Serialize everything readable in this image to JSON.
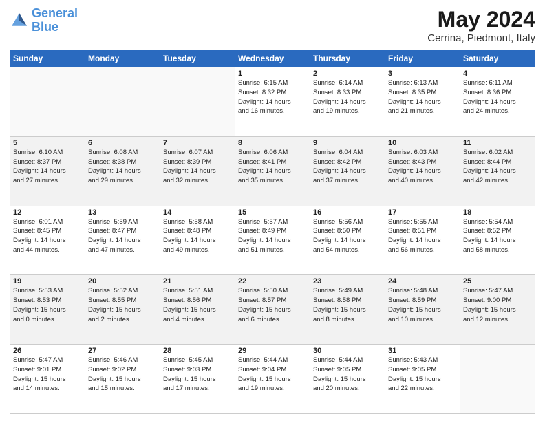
{
  "header": {
    "logo_line1": "General",
    "logo_line2": "Blue",
    "month": "May 2024",
    "location": "Cerrina, Piedmont, Italy"
  },
  "weekdays": [
    "Sunday",
    "Monday",
    "Tuesday",
    "Wednesday",
    "Thursday",
    "Friday",
    "Saturday"
  ],
  "weeks": [
    [
      {
        "day": "",
        "info": ""
      },
      {
        "day": "",
        "info": ""
      },
      {
        "day": "",
        "info": ""
      },
      {
        "day": "1",
        "info": "Sunrise: 6:15 AM\nSunset: 8:32 PM\nDaylight: 14 hours\nand 16 minutes."
      },
      {
        "day": "2",
        "info": "Sunrise: 6:14 AM\nSunset: 8:33 PM\nDaylight: 14 hours\nand 19 minutes."
      },
      {
        "day": "3",
        "info": "Sunrise: 6:13 AM\nSunset: 8:35 PM\nDaylight: 14 hours\nand 21 minutes."
      },
      {
        "day": "4",
        "info": "Sunrise: 6:11 AM\nSunset: 8:36 PM\nDaylight: 14 hours\nand 24 minutes."
      }
    ],
    [
      {
        "day": "5",
        "info": "Sunrise: 6:10 AM\nSunset: 8:37 PM\nDaylight: 14 hours\nand 27 minutes."
      },
      {
        "day": "6",
        "info": "Sunrise: 6:08 AM\nSunset: 8:38 PM\nDaylight: 14 hours\nand 29 minutes."
      },
      {
        "day": "7",
        "info": "Sunrise: 6:07 AM\nSunset: 8:39 PM\nDaylight: 14 hours\nand 32 minutes."
      },
      {
        "day": "8",
        "info": "Sunrise: 6:06 AM\nSunset: 8:41 PM\nDaylight: 14 hours\nand 35 minutes."
      },
      {
        "day": "9",
        "info": "Sunrise: 6:04 AM\nSunset: 8:42 PM\nDaylight: 14 hours\nand 37 minutes."
      },
      {
        "day": "10",
        "info": "Sunrise: 6:03 AM\nSunset: 8:43 PM\nDaylight: 14 hours\nand 40 minutes."
      },
      {
        "day": "11",
        "info": "Sunrise: 6:02 AM\nSunset: 8:44 PM\nDaylight: 14 hours\nand 42 minutes."
      }
    ],
    [
      {
        "day": "12",
        "info": "Sunrise: 6:01 AM\nSunset: 8:45 PM\nDaylight: 14 hours\nand 44 minutes."
      },
      {
        "day": "13",
        "info": "Sunrise: 5:59 AM\nSunset: 8:47 PM\nDaylight: 14 hours\nand 47 minutes."
      },
      {
        "day": "14",
        "info": "Sunrise: 5:58 AM\nSunset: 8:48 PM\nDaylight: 14 hours\nand 49 minutes."
      },
      {
        "day": "15",
        "info": "Sunrise: 5:57 AM\nSunset: 8:49 PM\nDaylight: 14 hours\nand 51 minutes."
      },
      {
        "day": "16",
        "info": "Sunrise: 5:56 AM\nSunset: 8:50 PM\nDaylight: 14 hours\nand 54 minutes."
      },
      {
        "day": "17",
        "info": "Sunrise: 5:55 AM\nSunset: 8:51 PM\nDaylight: 14 hours\nand 56 minutes."
      },
      {
        "day": "18",
        "info": "Sunrise: 5:54 AM\nSunset: 8:52 PM\nDaylight: 14 hours\nand 58 minutes."
      }
    ],
    [
      {
        "day": "19",
        "info": "Sunrise: 5:53 AM\nSunset: 8:53 PM\nDaylight: 15 hours\nand 0 minutes."
      },
      {
        "day": "20",
        "info": "Sunrise: 5:52 AM\nSunset: 8:55 PM\nDaylight: 15 hours\nand 2 minutes."
      },
      {
        "day": "21",
        "info": "Sunrise: 5:51 AM\nSunset: 8:56 PM\nDaylight: 15 hours\nand 4 minutes."
      },
      {
        "day": "22",
        "info": "Sunrise: 5:50 AM\nSunset: 8:57 PM\nDaylight: 15 hours\nand 6 minutes."
      },
      {
        "day": "23",
        "info": "Sunrise: 5:49 AM\nSunset: 8:58 PM\nDaylight: 15 hours\nand 8 minutes."
      },
      {
        "day": "24",
        "info": "Sunrise: 5:48 AM\nSunset: 8:59 PM\nDaylight: 15 hours\nand 10 minutes."
      },
      {
        "day": "25",
        "info": "Sunrise: 5:47 AM\nSunset: 9:00 PM\nDaylight: 15 hours\nand 12 minutes."
      }
    ],
    [
      {
        "day": "26",
        "info": "Sunrise: 5:47 AM\nSunset: 9:01 PM\nDaylight: 15 hours\nand 14 minutes."
      },
      {
        "day": "27",
        "info": "Sunrise: 5:46 AM\nSunset: 9:02 PM\nDaylight: 15 hours\nand 15 minutes."
      },
      {
        "day": "28",
        "info": "Sunrise: 5:45 AM\nSunset: 9:03 PM\nDaylight: 15 hours\nand 17 minutes."
      },
      {
        "day": "29",
        "info": "Sunrise: 5:44 AM\nSunset: 9:04 PM\nDaylight: 15 hours\nand 19 minutes."
      },
      {
        "day": "30",
        "info": "Sunrise: 5:44 AM\nSunset: 9:05 PM\nDaylight: 15 hours\nand 20 minutes."
      },
      {
        "day": "31",
        "info": "Sunrise: 5:43 AM\nSunset: 9:05 PM\nDaylight: 15 hours\nand 22 minutes."
      },
      {
        "day": "",
        "info": ""
      }
    ]
  ],
  "shaded_weeks": [
    1,
    3
  ],
  "colors": {
    "header_bg": "#2a6abf",
    "shaded_cell": "#f2f2f2",
    "empty_cell": "#f9f9f9"
  }
}
